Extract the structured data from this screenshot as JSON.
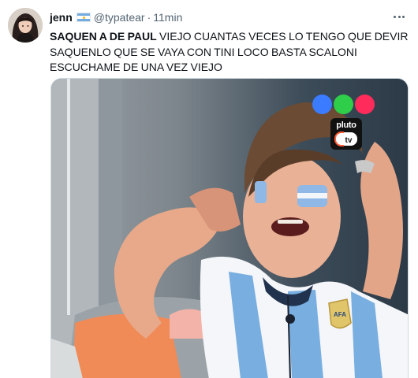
{
  "tweet": {
    "display_name": "jenn",
    "handle": "@typatear",
    "separator": "·",
    "time": "11min",
    "text_bold": "SAQUEN A DE PAUL",
    "text_rest": " VIEJO CUANTAS VECES LO TENGO QUE DEVIR SAQUENLO QUE SE VAYA CON TINI LOCO BASTA SCALONI ESCUCHAME DE UNA VEZ VIEJO"
  },
  "media": {
    "channel_logo_colors": [
      "#3b7bff",
      "#2fce4a",
      "#ff2b5a"
    ],
    "badge_top": "pluto",
    "badge_bottom": "tv",
    "jersey_patch_text": "AFA"
  },
  "icons": {
    "flag": "argentina-flag-icon",
    "more": "more-options-icon"
  },
  "colors": {
    "text_primary": "#0f1419",
    "text_secondary": "#536471",
    "argentina_blue": "#74acdf"
  }
}
